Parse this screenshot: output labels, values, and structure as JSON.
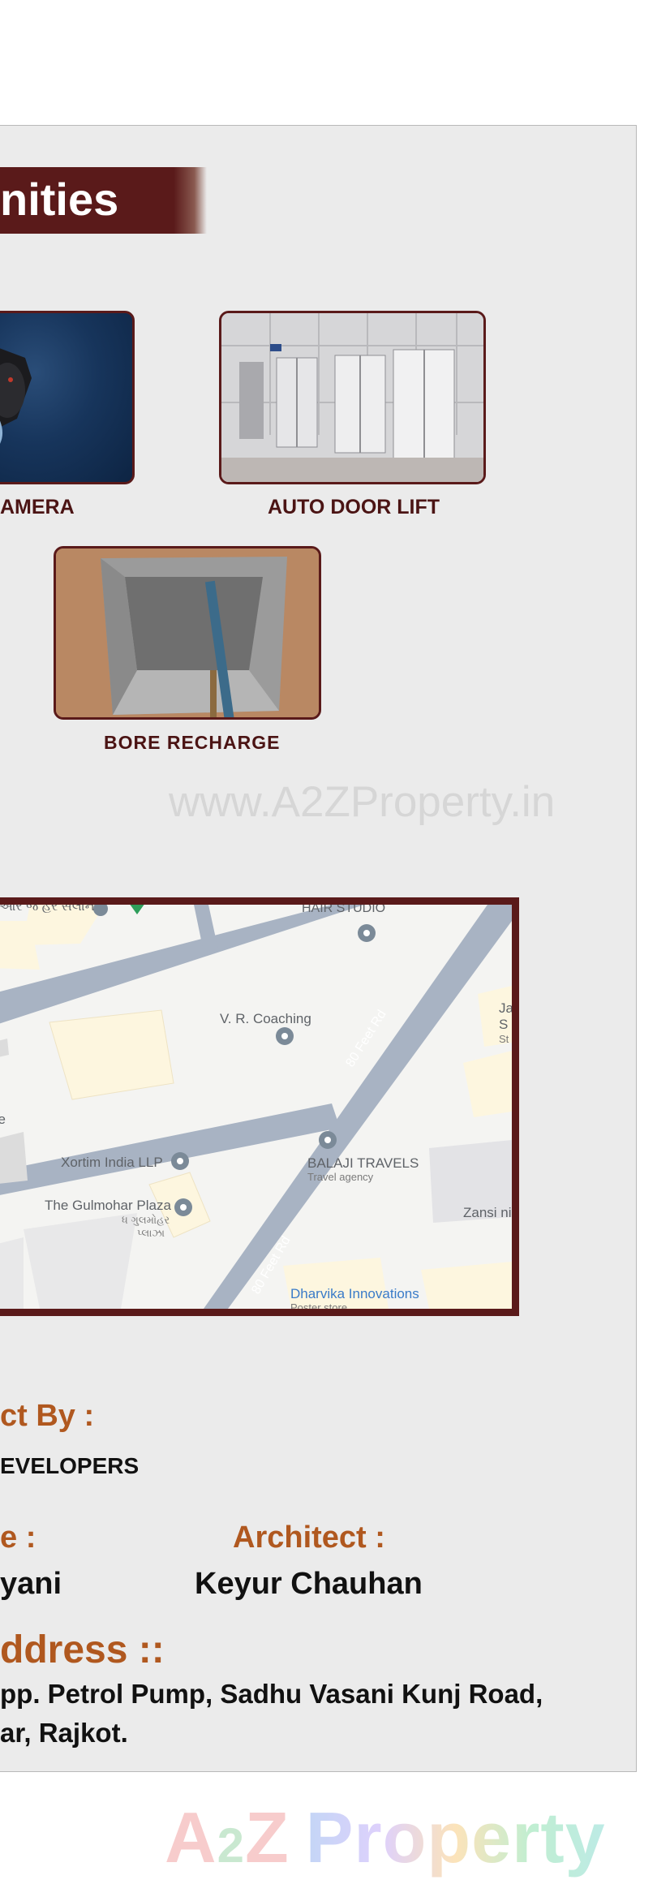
{
  "amenities": {
    "heading": "nities",
    "items": [
      {
        "caption": "AMERA"
      },
      {
        "caption": "AUTO DOOR LIFT"
      },
      {
        "caption": "BORE RECHARGE"
      }
    ]
  },
  "watermark": "www.A2ZProperty.in",
  "map": {
    "labels": {
      "top_left": "આર જ હર સલાન",
      "hair_studio": "HAIR STUDIO",
      "vr_coaching": "V. R. Coaching",
      "road_upper": "80 Feet Rd",
      "road_lower": "80 Feet Rd",
      "ce": "ce",
      "xortim": "Xortim India LLP",
      "balaji": "BALAJI TRAVELS",
      "balaji_sub": "Travel agency",
      "gulmohar": "The Gulmohar Plaza",
      "gulmohar_sub1": "ધ ગુલમોહર",
      "gulmohar_sub2": "પ્લાઝા",
      "zansi": "Zansi ni",
      "dharvika": "Dharvika Innovations",
      "dharvika_sub": "Poster store",
      "edge_ja": "Ja",
      "edge_s1": "S",
      "edge_s2": "St"
    }
  },
  "credits": {
    "by_label": "ct By :",
    "by_value": "EVELOPERS",
    "left_label": "e :",
    "left_value": "yani",
    "architect_label": "Architect :",
    "architect_value": "Keyur Chauhan"
  },
  "address": {
    "heading": "ddress ::",
    "line1": "pp. Petrol Pump, Sadhu Vasani Kunj Road,",
    "line2": "ar, Rajkot."
  },
  "logo": {
    "text_a": "A",
    "text_2": "2",
    "text_z": "Z",
    "text_property": "Property"
  },
  "colors": {
    "maroon": "#5a1a1a",
    "orange": "#b0581f",
    "panel": "#ebebeb"
  }
}
